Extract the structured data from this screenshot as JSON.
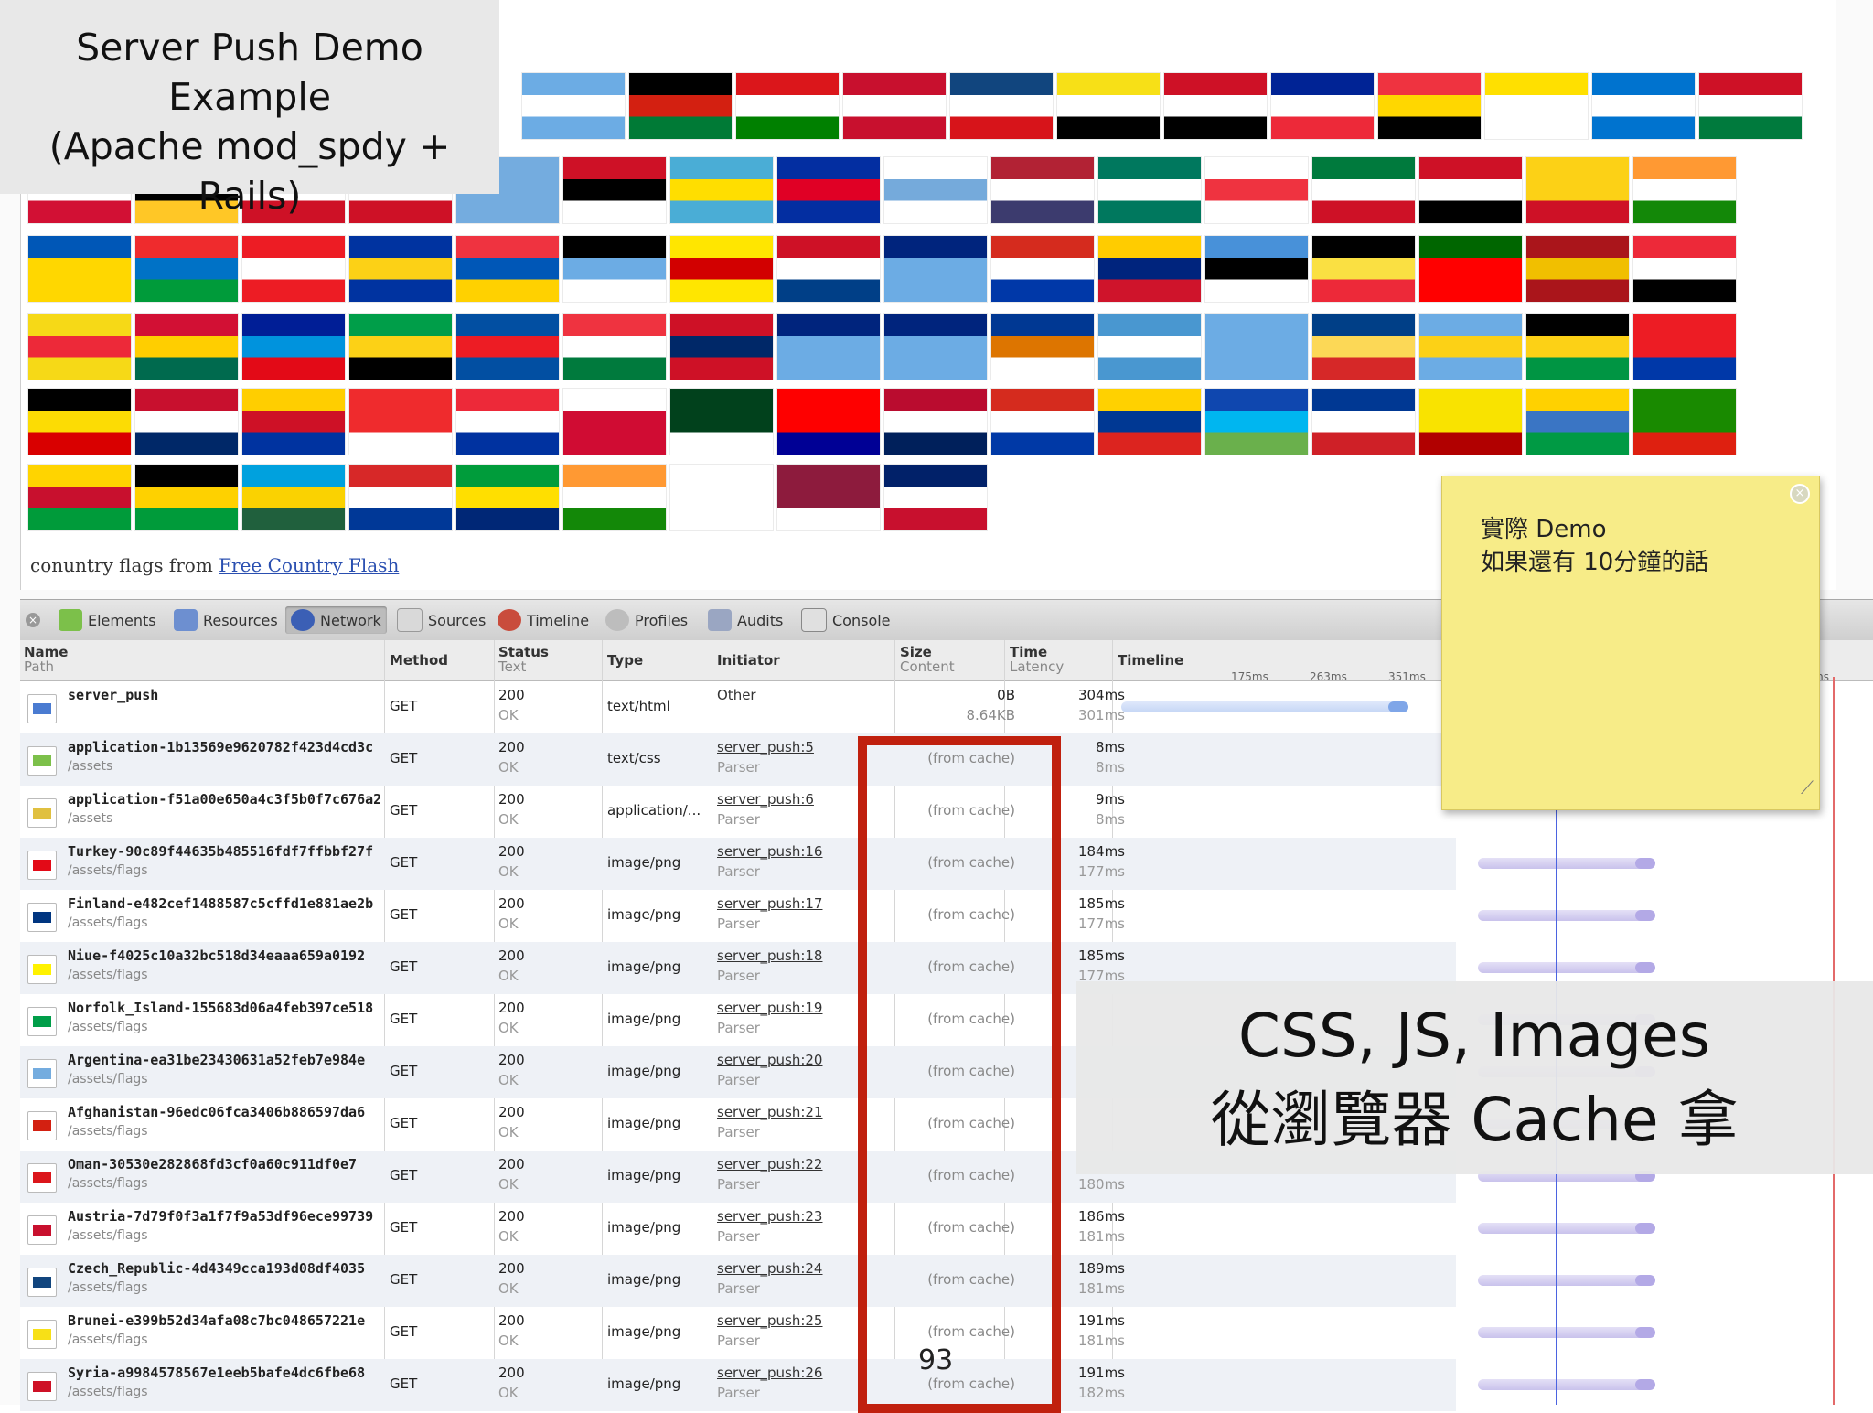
{
  "title_box": {
    "line1": "Server Push Demo",
    "line2": "Example",
    "line3": "(Apache mod_spdy + Rails)"
  },
  "credit": {
    "text": "conuntry flags from ",
    "link": "Free Country Flash"
  },
  "sticky_note": {
    "line1": "實際 Demo",
    "line2": "如果還有 10分鐘的話"
  },
  "overlay": {
    "line1": "CSS, JS, Images",
    "line2": "從瀏覽器 Cache 拿"
  },
  "slide_number": "93",
  "devtools": {
    "tabs": [
      "Elements",
      "Resources",
      "Network",
      "Sources",
      "Timeline",
      "Profiles",
      "Audits",
      "Console"
    ],
    "active_tab": "Network",
    "headers": {
      "name": "Name",
      "path": "Path",
      "method": "Method",
      "status": "Status",
      "status_text": "Text",
      "type": "Type",
      "initiator": "Initiator",
      "size": "Size",
      "content": "Content",
      "time": "Time",
      "latency": "Latency",
      "timeline": "Timeline"
    },
    "timeline_ticks": [
      "175ms",
      "263ms",
      "351ms",
      "ms"
    ],
    "rows": [
      {
        "name": "server_push",
        "path": "",
        "method": "GET",
        "status": "200",
        "status_text": "OK",
        "type": "text/html",
        "initiator": "Other",
        "initiator_type": "",
        "size": "0B",
        "content": "8.64KB",
        "time": "304ms",
        "latency": "301ms"
      },
      {
        "name": "application-1b13569e9620782f423d4cd3c",
        "path": "/assets",
        "method": "GET",
        "status": "200",
        "status_text": "OK",
        "type": "text/css",
        "initiator": "server_push:5",
        "initiator_type": "Parser",
        "size": "(from cache)",
        "content": "",
        "time": "8ms",
        "latency": "8ms"
      },
      {
        "name": "application-f51a00e650a4c3f5b0f7c676a2",
        "path": "/assets",
        "method": "GET",
        "status": "200",
        "status_text": "OK",
        "type": "application/...",
        "initiator": "server_push:6",
        "initiator_type": "Parser",
        "size": "(from cache)",
        "content": "",
        "time": "9ms",
        "latency": "8ms"
      },
      {
        "name": "Turkey-90c89f44635b485516fdf7ffbbf27f",
        "path": "/assets/flags",
        "method": "GET",
        "status": "200",
        "status_text": "OK",
        "type": "image/png",
        "initiator": "server_push:16",
        "initiator_type": "Parser",
        "size": "(from cache)",
        "content": "",
        "time": "184ms",
        "latency": "177ms"
      },
      {
        "name": "Finland-e482cef1488587c5cffd1e881ae2b",
        "path": "/assets/flags",
        "method": "GET",
        "status": "200",
        "status_text": "OK",
        "type": "image/png",
        "initiator": "server_push:17",
        "initiator_type": "Parser",
        "size": "(from cache)",
        "content": "",
        "time": "185ms",
        "latency": "177ms"
      },
      {
        "name": "Niue-f4025c10a32bc518d34eaaa659a0192",
        "path": "/assets/flags",
        "method": "GET",
        "status": "200",
        "status_text": "OK",
        "type": "image/png",
        "initiator": "server_push:18",
        "initiator_type": "Parser",
        "size": "(from cache)",
        "content": "",
        "time": "185ms",
        "latency": "177ms"
      },
      {
        "name": "Norfolk_Island-155683d06a4feb397ce518",
        "path": "/assets/flags",
        "method": "GET",
        "status": "200",
        "status_text": "OK",
        "type": "image/png",
        "initiator": "server_push:19",
        "initiator_type": "Parser",
        "size": "(from cache)",
        "content": "",
        "time": "",
        "latency": ""
      },
      {
        "name": "Argentina-ea31be23430631a52feb7e984e",
        "path": "/assets/flags",
        "method": "GET",
        "status": "200",
        "status_text": "OK",
        "type": "image/png",
        "initiator": "server_push:20",
        "initiator_type": "Parser",
        "size": "(from cache)",
        "content": "",
        "time": "",
        "latency": ""
      },
      {
        "name": "Afghanistan-96edc06fca3406b886597da6",
        "path": "/assets/flags",
        "method": "GET",
        "status": "200",
        "status_text": "OK",
        "type": "image/png",
        "initiator": "server_push:21",
        "initiator_type": "Parser",
        "size": "(from cache)",
        "content": "",
        "time": "",
        "latency": ""
      },
      {
        "name": "Oman-30530e282868fd3cf0a60c911df0e7",
        "path": "/assets/flags",
        "method": "GET",
        "status": "200",
        "status_text": "OK",
        "type": "image/png",
        "initiator": "server_push:22",
        "initiator_type": "Parser",
        "size": "(from cache)",
        "content": "",
        "time": "",
        "latency": "180ms"
      },
      {
        "name": "Austria-7d79f0f3a1f7f9a53df96ece99739",
        "path": "/assets/flags",
        "method": "GET",
        "status": "200",
        "status_text": "OK",
        "type": "image/png",
        "initiator": "server_push:23",
        "initiator_type": "Parser",
        "size": "(from cache)",
        "content": "",
        "time": "186ms",
        "latency": "181ms"
      },
      {
        "name": "Czech_Republic-4d4349cca193d08df4035",
        "path": "/assets/flags",
        "method": "GET",
        "status": "200",
        "status_text": "OK",
        "type": "image/png",
        "initiator": "server_push:24",
        "initiator_type": "Parser",
        "size": "(from cache)",
        "content": "",
        "time": "189ms",
        "latency": "181ms"
      },
      {
        "name": "Brunei-e399b52d34afa08c7bc048657221e",
        "path": "/assets/flags",
        "method": "GET",
        "status": "200",
        "status_text": "OK",
        "type": "image/png",
        "initiator": "server_push:25",
        "initiator_type": "Parser",
        "size": "(from cache)",
        "content": "",
        "time": "191ms",
        "latency": "181ms"
      },
      {
        "name": "Syria-a9984578567e1eeb5bafe4dc6fbe68",
        "path": "/assets/flags",
        "method": "GET",
        "status": "200",
        "status_text": "OK",
        "type": "image/png",
        "initiator": "server_push:26",
        "initiator_type": "Parser",
        "size": "(from cache)",
        "content": "",
        "time": "191ms",
        "latency": "182ms"
      }
    ]
  },
  "flags": [
    [
      "#6cace4,#ffffff,#6cace4",
      "#000,#d32011,#007a36",
      "#db161b,#fff,#008000",
      "#c8102e,#fff,#c8102e",
      "#11457e,#fff,#d7141a",
      "#f7e017,#fff,#000",
      "#ce1126,#fff,#000",
      "#002395,#fff,#ed2939",
      "#ef3340,#ffd700,#000",
      "#ffe000,#fff,#fff",
      "#0073cf,#fff,#0073cf",
      "#ce1126,#fff,#007a3d",
      "#fff,#005ce5,#ed1c24",
      "#00247d,#00247d,#00247d"
    ],
    [
      "#d21034,#fff,#d21034",
      "#dc241f,#000,#ffc726",
      "#1eb53a,#fff,#ce1126",
      "#ce1126,#fff,#ce1126",
      "#74acdf,#74acdf,#74acdf",
      "#ce1126,#000,#fff",
      "#4aadd6,#ffde00,#4aadd6",
      "#032ea1,#e00025,#032ea1",
      "#fff,#75aadb,#fff",
      "#b22234,#fff,#3c3b6e",
      "#00785e,#fff,#00785e",
      "#fff,#ef3340,#fff",
      "#007a3d,#fff,#ce1126",
      "#ce1126,#fff,#000",
      "#fcd116,#fcd116,#ce1126",
      "#ff9933,#fff,#138808"
    ],
    [
      "#0057b7,#ffd700,#ffd700",
      "#ef2b2d,#0072c6,#009b3a",
      "#ed1c24,#fff,#ed1c24",
      "#0033a0,#fcd116,#0033a0",
      "#ef3340,#0057b7,#ffd100",
      "#000,#6cace4,#fff",
      "#ffe600,#d20000,#ffe600",
      "#ce1126,#fff,#003f87",
      "#00247d,#6cace4,#6cace4",
      "#d52b1e,#fff,#0038a8",
      "#ffcc00,#00247d,#cf142b",
      "#4891d9,#000,#fff",
      "#000,#fae042,#ed2939",
      "#006600,#ff0000,#ff0000",
      "#aa151b,#f1bf00,#aa151b",
      "#ed2939,#fff,#000"
    ],
    [
      "#f6d917,#ed2939,#f6d917",
      "#d21034,#ffce00,#006a4e",
      "#001e96,#0093dd,#e30a17",
      "#009e49,#fcd116,#000",
      "#024fa2,#ed1c24,#024fa2",
      "#ef3340,#fff,#007a3d",
      "#ce1126,#002868,#ce1126",
      "#00247d,#6cace4,#6cace4",
      "#00247d,#6cace4,#6cace4",
      "#003893,#dd7500,#fff",
      "#4997d0,#fff,#4997d0",
      "#6cace4,#6cace4,#6cace4",
      "#003f87,#fcd856,#d62828",
      "#6cace4,#fcd116,#6cace4",
      "#000,#fcd116,#009543",
      "#ed1c24,#ed1c24,#0038a8"
    ],
    [
      "#000,#fcdc04,#d90000",
      "#c8102e,#fff,#002868",
      "#ffce00,#ce1126,#0033a0",
      "#ef2b2d,#ef2b2d,#fff",
      "#ed2939,#fff,#0032a0",
      "#fff,#d00c33,#d00c33",
      "#01411c,#01411c,#fff",
      "#fe0000,#fe0000,#000095",
      "#ba0c2f,#fff,#00205b",
      "#d52b1e,#fff,#0039a6",
      "#ffd100,#003893,#dc241f",
      "#0f47af,#00b6f0,#6ab04c",
      "#003893,#fff,#cf2027",
      "#f9e300,#f9e300,#b10000",
      "#ffd100,#3a75c4,#009a44",
      "#198a00,#198a00,#de2010"
    ],
    [
      "#ffd400,#c8102e,#009b3a",
      "#000,#fed100,#009b3a",
      "#00a1de,#fad201,#20603d",
      "#d72828,#fff,#003897",
      "#009c3b,#ffdf00,#002776",
      "#ff9933,#fff,#138808",
      "#fff,#fff,#fff",
      "#8d1b3d,#8d1b3d,#fff",
      "#012169,#fff,#c8102e"
    ]
  ]
}
